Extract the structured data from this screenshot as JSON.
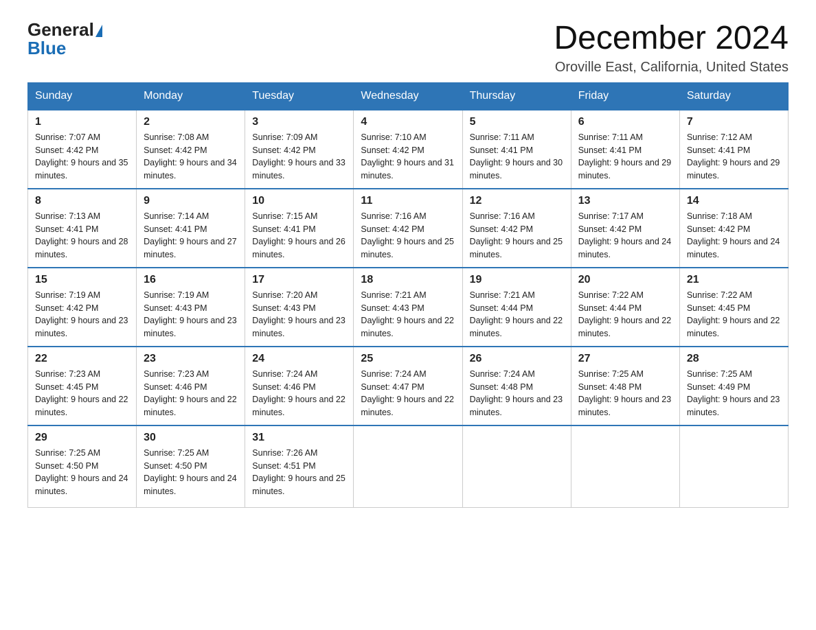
{
  "header": {
    "logo_general": "General",
    "logo_blue": "Blue",
    "month_title": "December 2024",
    "location": "Oroville East, California, United States"
  },
  "weekdays": [
    "Sunday",
    "Monday",
    "Tuesday",
    "Wednesday",
    "Thursday",
    "Friday",
    "Saturday"
  ],
  "weeks": [
    [
      {
        "day": "1",
        "sunrise": "7:07 AM",
        "sunset": "4:42 PM",
        "daylight": "9 hours and 35 minutes."
      },
      {
        "day": "2",
        "sunrise": "7:08 AM",
        "sunset": "4:42 PM",
        "daylight": "9 hours and 34 minutes."
      },
      {
        "day": "3",
        "sunrise": "7:09 AM",
        "sunset": "4:42 PM",
        "daylight": "9 hours and 33 minutes."
      },
      {
        "day": "4",
        "sunrise": "7:10 AM",
        "sunset": "4:42 PM",
        "daylight": "9 hours and 31 minutes."
      },
      {
        "day": "5",
        "sunrise": "7:11 AM",
        "sunset": "4:41 PM",
        "daylight": "9 hours and 30 minutes."
      },
      {
        "day": "6",
        "sunrise": "7:11 AM",
        "sunset": "4:41 PM",
        "daylight": "9 hours and 29 minutes."
      },
      {
        "day": "7",
        "sunrise": "7:12 AM",
        "sunset": "4:41 PM",
        "daylight": "9 hours and 29 minutes."
      }
    ],
    [
      {
        "day": "8",
        "sunrise": "7:13 AM",
        "sunset": "4:41 PM",
        "daylight": "9 hours and 28 minutes."
      },
      {
        "day": "9",
        "sunrise": "7:14 AM",
        "sunset": "4:41 PM",
        "daylight": "9 hours and 27 minutes."
      },
      {
        "day": "10",
        "sunrise": "7:15 AM",
        "sunset": "4:41 PM",
        "daylight": "9 hours and 26 minutes."
      },
      {
        "day": "11",
        "sunrise": "7:16 AM",
        "sunset": "4:42 PM",
        "daylight": "9 hours and 25 minutes."
      },
      {
        "day": "12",
        "sunrise": "7:16 AM",
        "sunset": "4:42 PM",
        "daylight": "9 hours and 25 minutes."
      },
      {
        "day": "13",
        "sunrise": "7:17 AM",
        "sunset": "4:42 PM",
        "daylight": "9 hours and 24 minutes."
      },
      {
        "day": "14",
        "sunrise": "7:18 AM",
        "sunset": "4:42 PM",
        "daylight": "9 hours and 24 minutes."
      }
    ],
    [
      {
        "day": "15",
        "sunrise": "7:19 AM",
        "sunset": "4:42 PM",
        "daylight": "9 hours and 23 minutes."
      },
      {
        "day": "16",
        "sunrise": "7:19 AM",
        "sunset": "4:43 PM",
        "daylight": "9 hours and 23 minutes."
      },
      {
        "day": "17",
        "sunrise": "7:20 AM",
        "sunset": "4:43 PM",
        "daylight": "9 hours and 23 minutes."
      },
      {
        "day": "18",
        "sunrise": "7:21 AM",
        "sunset": "4:43 PM",
        "daylight": "9 hours and 22 minutes."
      },
      {
        "day": "19",
        "sunrise": "7:21 AM",
        "sunset": "4:44 PM",
        "daylight": "9 hours and 22 minutes."
      },
      {
        "day": "20",
        "sunrise": "7:22 AM",
        "sunset": "4:44 PM",
        "daylight": "9 hours and 22 minutes."
      },
      {
        "day": "21",
        "sunrise": "7:22 AM",
        "sunset": "4:45 PM",
        "daylight": "9 hours and 22 minutes."
      }
    ],
    [
      {
        "day": "22",
        "sunrise": "7:23 AM",
        "sunset": "4:45 PM",
        "daylight": "9 hours and 22 minutes."
      },
      {
        "day": "23",
        "sunrise": "7:23 AM",
        "sunset": "4:46 PM",
        "daylight": "9 hours and 22 minutes."
      },
      {
        "day": "24",
        "sunrise": "7:24 AM",
        "sunset": "4:46 PM",
        "daylight": "9 hours and 22 minutes."
      },
      {
        "day": "25",
        "sunrise": "7:24 AM",
        "sunset": "4:47 PM",
        "daylight": "9 hours and 22 minutes."
      },
      {
        "day": "26",
        "sunrise": "7:24 AM",
        "sunset": "4:48 PM",
        "daylight": "9 hours and 23 minutes."
      },
      {
        "day": "27",
        "sunrise": "7:25 AM",
        "sunset": "4:48 PM",
        "daylight": "9 hours and 23 minutes."
      },
      {
        "day": "28",
        "sunrise": "7:25 AM",
        "sunset": "4:49 PM",
        "daylight": "9 hours and 23 minutes."
      }
    ],
    [
      {
        "day": "29",
        "sunrise": "7:25 AM",
        "sunset": "4:50 PM",
        "daylight": "9 hours and 24 minutes."
      },
      {
        "day": "30",
        "sunrise": "7:25 AM",
        "sunset": "4:50 PM",
        "daylight": "9 hours and 24 minutes."
      },
      {
        "day": "31",
        "sunrise": "7:26 AM",
        "sunset": "4:51 PM",
        "daylight": "9 hours and 25 minutes."
      },
      null,
      null,
      null,
      null
    ]
  ],
  "labels": {
    "sunrise_prefix": "Sunrise: ",
    "sunset_prefix": "Sunset: ",
    "daylight_prefix": "Daylight: "
  }
}
